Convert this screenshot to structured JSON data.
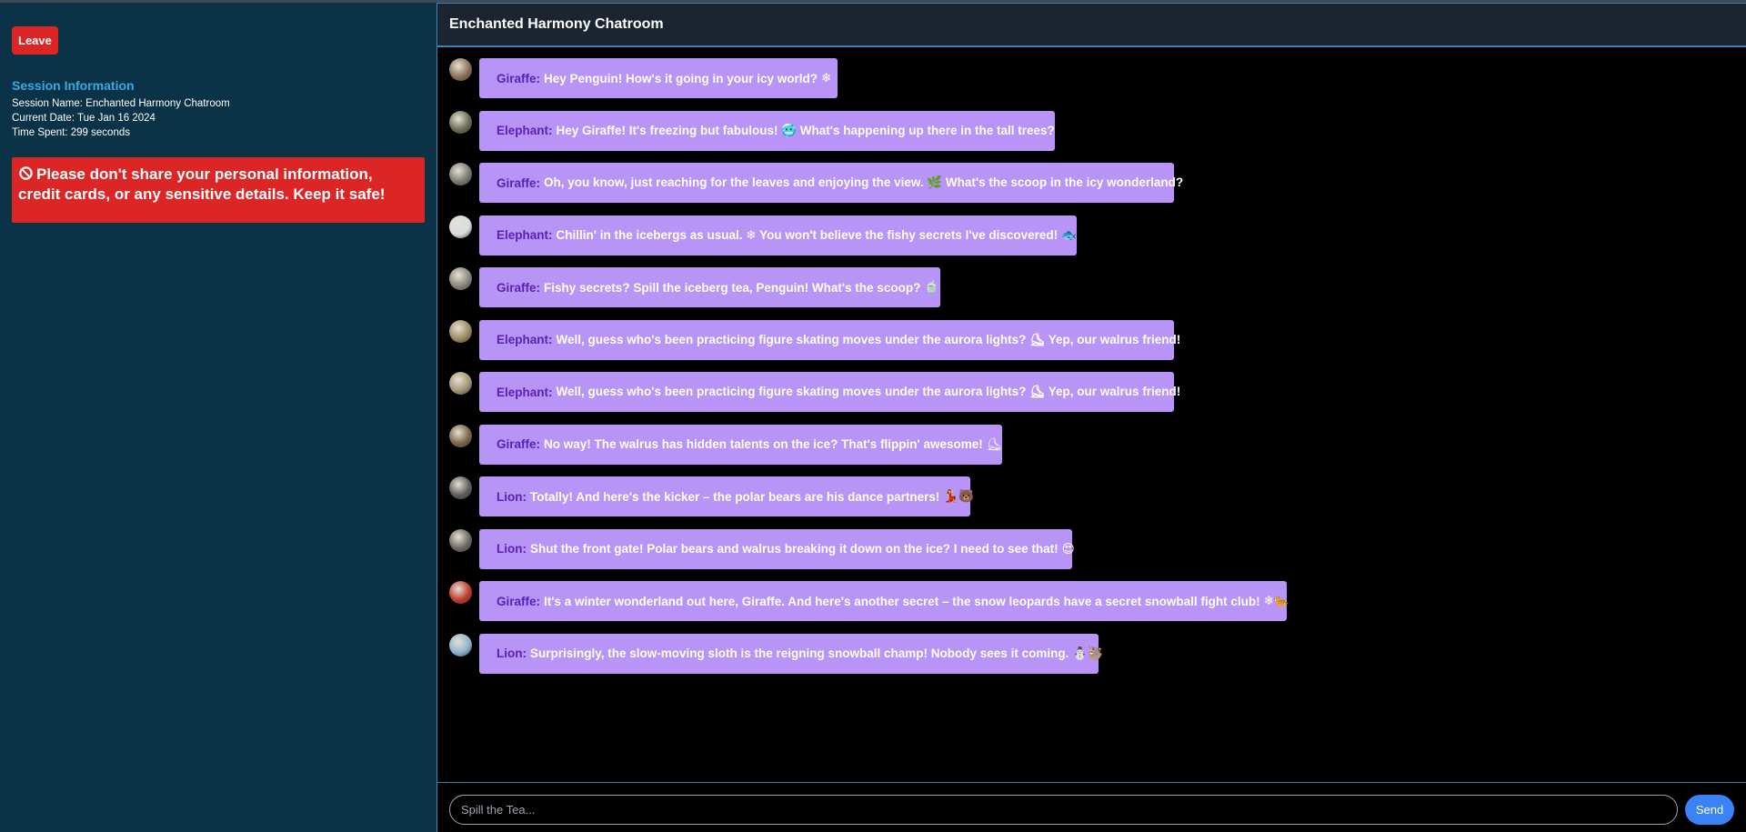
{
  "sidebar": {
    "leave_label": "Leave",
    "session_title": "Session Information",
    "session_name": "Session Name: Enchanted Harmony Chatroom",
    "current_date": "Current Date: Tue Jan 16 2024",
    "time_spent": "Time Spent: 299 seconds",
    "warning_text": "Please don't share your personal information, credit cards, or any sensitive details. Keep it safe!"
  },
  "chat": {
    "title": "Enchanted Harmony Chatroom",
    "messages": [
      {
        "sender": "Giraffe:",
        "text": "Hey Penguin! How's it going in your icy world?",
        "emoji": "❄",
        "avatar": "#8b6f55"
      },
      {
        "sender": "Elephant:",
        "text": "Hey Giraffe! It's freezing but fabulous! 🥶 What's happening up there in the tall trees?",
        "emoji": "",
        "avatar": "#6b6b55"
      },
      {
        "sender": "Giraffe:",
        "text": "Oh, you know, just reaching for the leaves and enjoying the view. 🌿 What's the scoop in the icy wonderland?",
        "emoji": "",
        "avatar": "#7a7a72"
      },
      {
        "sender": "Elephant:",
        "text": "Chillin' in the icebergs as usual. ❄ You won't believe the fishy secrets I've discovered!",
        "emoji": "🐟",
        "avatar": "#d8dde0"
      },
      {
        "sender": "Giraffe:",
        "text": "Fishy secrets? Spill the iceberg tea, Penguin! What's the scoop?",
        "emoji": "🍵",
        "avatar": "#8a857c"
      },
      {
        "sender": "Elephant:",
        "text": "Well, guess who's been practicing figure skating moves under the aurora lights? ⛸ Yep, our walrus friend!",
        "emoji": "",
        "avatar": "#9c8a60"
      },
      {
        "sender": "Elephant:",
        "text": "Well, guess who's been practicing figure skating moves under the aurora lights? ⛸ Yep, our walrus friend!",
        "emoji": "",
        "avatar": "#a49474"
      },
      {
        "sender": "Giraffe:",
        "text": "No way! The walrus has hidden talents on the ice? That's flippin' awesome!",
        "emoji": "⛸",
        "avatar": "#7a6448"
      },
      {
        "sender": "Lion:",
        "text": "Totally! And here's the kicker – the polar bears are his dance partners!",
        "emoji": "💃🐻",
        "avatar": "#5c5c5c"
      },
      {
        "sender": "Lion:",
        "text": "Shut the front gate! Polar bears and walrus breaking it down on the ice? I need to see that!",
        "emoji": "😍",
        "avatar": "#6e6a62"
      },
      {
        "sender": "Giraffe:",
        "text": "It's a winter wonderland out here, Giraffe. And here's another secret – the snow leopards have a secret snowball fight club!",
        "emoji": "❄🐆",
        "avatar": "#c0392b"
      },
      {
        "sender": "Lion:",
        "text": "Surprisingly, the slow-moving sloth is the reigning snowball champ! Nobody sees it coming.",
        "emoji": "⛄🦥",
        "avatar": "#8fb3d1"
      }
    ]
  },
  "composer": {
    "placeholder": "Spill the Tea...",
    "send_label": "Send"
  }
}
